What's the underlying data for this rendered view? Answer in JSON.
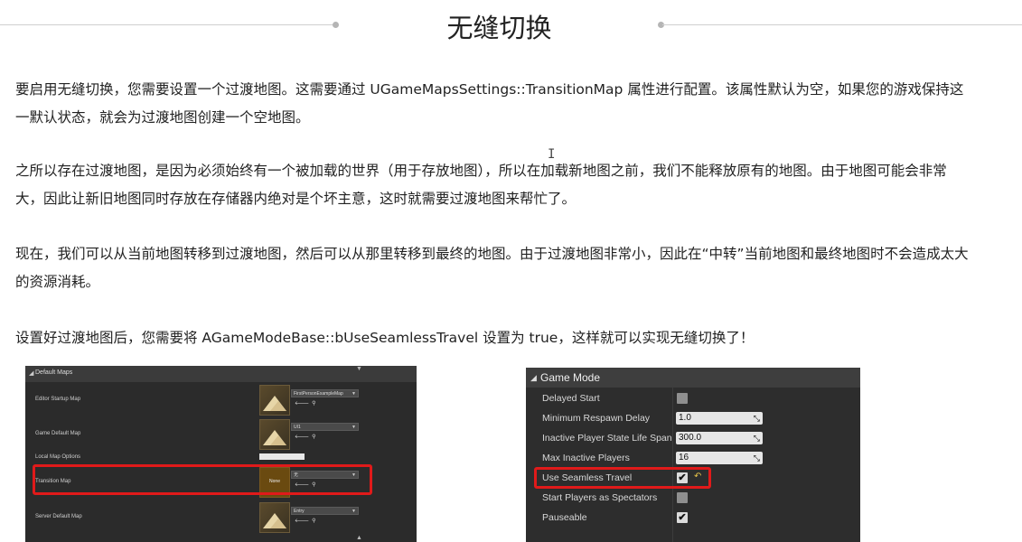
{
  "title": "无缝切换",
  "paragraphs": [
    "要启用无缝切换，您需要设置一个过渡地图。这需要通过 UGameMapsSettings::TransitionMap 属性进行配置。该属性默认为空，如果您的游戏保持这一默认状态，就会为过渡地图创建一个空地图。",
    "之所以存在过渡地图，是因为必须始终有一个被加载的世界（用于存放地图），所以在加载新地图之前，我们不能释放原有的地图。由于地图可能会非常大，因此让新旧地图同时存放在存储器内绝对是个坏主意，这时就需要过渡地图来帮忙了。",
    "现在，我们可以从当前地图转移到过渡地图，然后可以从那里转移到最终的地图。由于过渡地图非常小，因此在“中转”当前地图和最终地图时不会造成太大的资源消耗。",
    "设置好过渡地图后，您需要将 AGameModeBase::bUseSeamlessTravel 设置为 true，这样就可以实现无缝切换了！"
  ],
  "default_maps_panel": {
    "header": "Default Maps",
    "rows": [
      {
        "name": "Editor Startup Map",
        "value": "FirstPersonExampleMap"
      },
      {
        "name": "Game Default Map",
        "value": "UI1"
      },
      {
        "name": "Local Map Options",
        "value": ""
      },
      {
        "name": "Transition Map",
        "value": "无",
        "thumb_label": "None"
      },
      {
        "name": "Server Default Map",
        "value": "Entry"
      }
    ]
  },
  "game_mode_panel": {
    "header": "Game Mode",
    "rows": [
      {
        "name": "Delayed Start",
        "checked": false
      },
      {
        "name": "Minimum Respawn Delay",
        "value": "1.0"
      },
      {
        "name": "Inactive Player State Life Span",
        "value": "300.0"
      },
      {
        "name": "Max Inactive Players",
        "value": "16"
      },
      {
        "name": "Use Seamless Travel",
        "checked": true
      },
      {
        "name": "Start Players as Spectators",
        "checked": false
      },
      {
        "name": "Pauseable",
        "checked": true
      }
    ]
  },
  "icons": {
    "heading_ornament": "dot-line-ornament",
    "text_cursor": "i-beam-cursor-icon",
    "checkmark": "✔",
    "reset": "reset-arrow-icon",
    "resize": "resize-handle-icon"
  },
  "colors": {
    "highlight": "#e01a1a",
    "panel_bg": "#2d2d2d",
    "reset_icon": "#e6c34a"
  }
}
